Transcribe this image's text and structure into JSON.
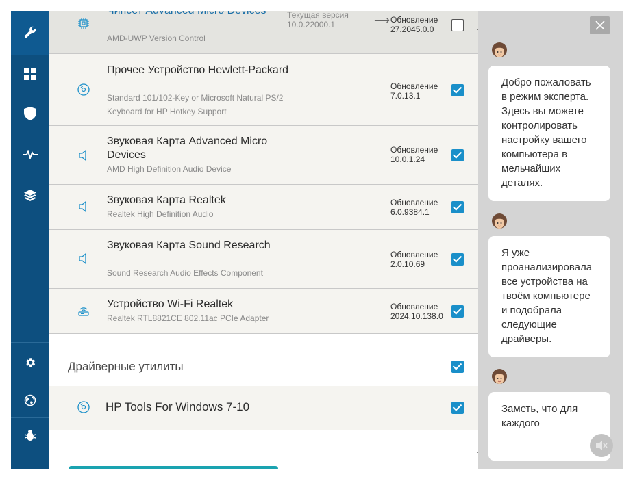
{
  "sidebar": {
    "icons": [
      "wrench-icon",
      "dashboard-grid-icon",
      "shield-icon",
      "pulse-icon",
      "layers-icon",
      "gear-icon",
      "globe-icon",
      "bug-icon"
    ]
  },
  "devices": [
    {
      "title": "Чипсет Advanced Micro Devices",
      "subtitle": "AMD-UWP Version Control",
      "current_label": "Текущая версия",
      "current_version": "10.0.22000.1",
      "update_label": "Обновление",
      "update_version": "27.2045.0.0",
      "checked": false,
      "icon": "chip-icon"
    },
    {
      "title": "Прочее Устройство Hewlett-Packard",
      "subtitle": "Standard 101/102-Key or Microsoft Natural PS/2 Keyboard for HP Hotkey Support",
      "update_label": "Обновление",
      "update_version": "7.0.13.1",
      "checked": true,
      "icon": "disc-icon"
    },
    {
      "title": "Звуковая Карта Advanced Micro Devices",
      "subtitle": "AMD High Definition Audio Device",
      "update_label": "Обновление",
      "update_version": "10.0.1.24",
      "checked": true,
      "icon": "speaker-icon"
    },
    {
      "title": "Звуковая Карта Realtek",
      "subtitle": "Realtek High Definition Audio",
      "update_label": "Обновление",
      "update_version": "6.0.9384.1",
      "checked": true,
      "icon": "speaker-icon"
    },
    {
      "title": "Звуковая Карта Sound Research",
      "subtitle": "Sound Research Audio Effects Component",
      "update_label": "Обновление",
      "update_version": "2.0.10.69",
      "checked": true,
      "icon": "speaker-icon"
    },
    {
      "title": "Устройство Wi-Fi Realtek",
      "subtitle": "Realtek RTL8821CE 802.11ac PCIe Adapter",
      "update_label": "Обновление",
      "update_version": "2024.10.138.0",
      "checked": true,
      "icon": "wifi-router-icon"
    }
  ],
  "utilities": {
    "section_label": "Драйверные утилиты",
    "section_checked": true,
    "items": [
      {
        "title": "HP Tools For Windows 7-10",
        "checked": true,
        "icon": "disc-icon"
      }
    ]
  },
  "chat": {
    "messages": [
      "Добро пожаловать в режим эксперта. Здесь вы можете контролировать настройку вашего компьютера в мельчайших деталях.",
      "Я уже проанализировала все устройства на твоём компьютере и подобрала следующие драйверы.",
      "Заметь, что для каждого"
    ]
  },
  "colors": {
    "sidebar": "#0d4f7f",
    "accent": "#1a8fc9",
    "chat_bg": "#d4d4d4"
  }
}
